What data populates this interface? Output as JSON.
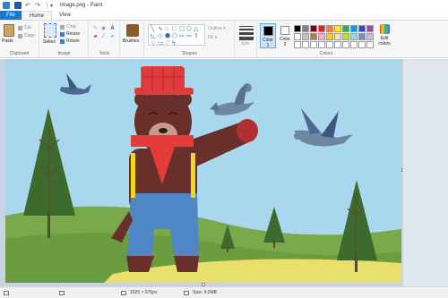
{
  "titlebar": {
    "title": "Image.png - Paint",
    "quick_access_dropdown": "▾"
  },
  "tabs": {
    "file": "File",
    "home": "Home",
    "view": "View"
  },
  "ribbon": {
    "clipboard": {
      "paste": "Paste",
      "cut": "Cut",
      "copy": "Copy",
      "label": "Clipboard"
    },
    "image": {
      "select": "Select",
      "crop": "Crop",
      "resize": "Resize",
      "rotate": "Rotate",
      "label": "Image"
    },
    "tools": {
      "text_tool": "A",
      "label": "Tools"
    },
    "brushes": {
      "label": "Brushes"
    },
    "shapes": {
      "outline": "Outline",
      "fill": "Fill",
      "label": "Shapes"
    },
    "size": {
      "label": "Size"
    },
    "colors": {
      "color1": "Color 1",
      "color2": "Color 2",
      "edit_colors": "Edit colors",
      "label": "Colors",
      "color1_value": "#000000",
      "color2_value": "#ffffff",
      "palette": [
        "#000000",
        "#7f7f7f",
        "#880015",
        "#ed1c24",
        "#ff7f27",
        "#fff200",
        "#22b14c",
        "#00a2e8",
        "#3f48cc",
        "#a349a4",
        "#ffffff",
        "#c3c3c3",
        "#b97a57",
        "#ffaec9",
        "#ffc90e",
        "#efe4b0",
        "#b5e61d",
        "#99d9ea",
        "#7092be",
        "#c8bfe7",
        "#ffffff",
        "#ffffff",
        "#ffffff",
        "#ffffff",
        "#ffffff",
        "#ffffff",
        "#ffffff",
        "#ffffff",
        "#ffffff",
        "#ffffff"
      ]
    }
  },
  "statusbar": {
    "dimensions": "1025 × 576px",
    "size": "Size: 4.0MB"
  },
  "canvas": {
    "sky_color": "#a9d8ee",
    "hill_color": "#79a94a",
    "path_color": "#e8e06a"
  }
}
